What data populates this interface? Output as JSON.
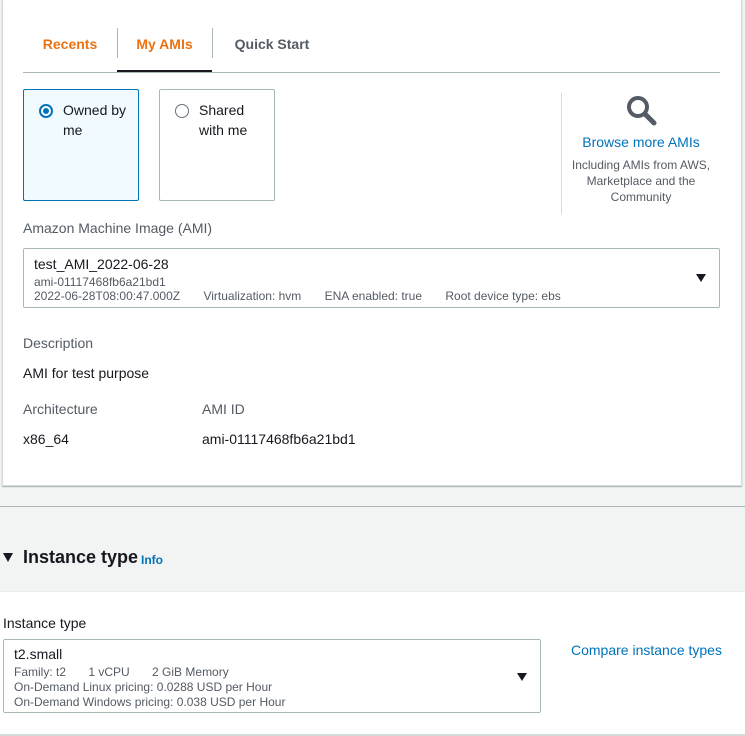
{
  "ami_tabs": [
    {
      "label": "Recents"
    },
    {
      "label": "My AMIs"
    },
    {
      "label": "Quick Start"
    }
  ],
  "ownership": {
    "owned_label": "Owned by me",
    "shared_label": "Shared with me",
    "selected": "owned"
  },
  "browse": {
    "icon": "search-icon",
    "link": "Browse more AMIs",
    "description": "Including AMIs from AWS, Marketplace and the Community"
  },
  "ami": {
    "label": "Amazon Machine Image (AMI)",
    "name": "test_AMI_2022-06-28",
    "id": "ami-01117468fb6a21bd1",
    "date": "2022-06-28T08:00:47.000Z",
    "virtualization": "Virtualization: hvm",
    "ena": "ENA enabled: true",
    "root_device": "Root device type: ebs"
  },
  "details": {
    "description_label": "Description",
    "description_value": "AMI for test purpose",
    "architecture_label": "Architecture",
    "architecture_value": "x86_64",
    "ami_id_label": "AMI ID",
    "ami_id_value": "ami-01117468fb6a21bd1"
  },
  "instance_section": {
    "title": "Instance type",
    "info": "Info",
    "field_label": "Instance type",
    "selected": "t2.small",
    "family": "Family: t2",
    "vcpu": "1 vCPU",
    "memory": "2 GiB Memory",
    "linux_pricing": "On-Demand Linux pricing: 0.0288 USD per Hour",
    "windows_pricing": "On-Demand Windows pricing: 0.038 USD per Hour",
    "compare_link": "Compare instance types"
  },
  "colors": {
    "tab_active": "#ec7211",
    "link": "#0073bb",
    "selected_tile_bg": "#f1faff"
  }
}
